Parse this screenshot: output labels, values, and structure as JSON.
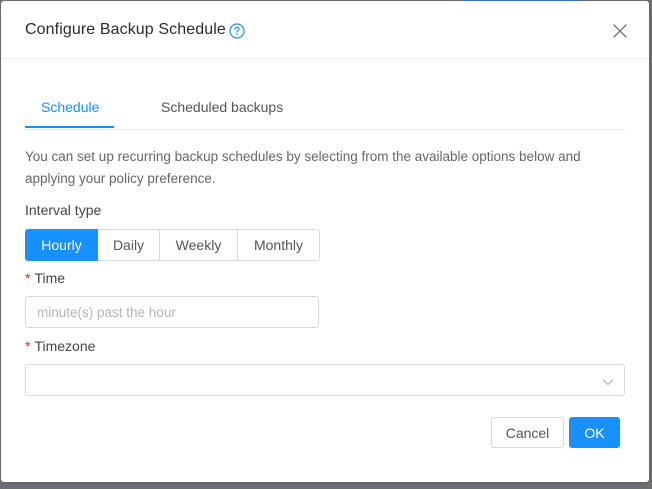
{
  "dialog": {
    "title": "Configure Backup Schedule",
    "help_icon": "question-circle-icon",
    "close_icon": "close-icon"
  },
  "tabs": [
    {
      "label": "Schedule",
      "active": true
    },
    {
      "label": "Scheduled backups",
      "active": false
    }
  ],
  "description": "You can set up recurring backup schedules by selecting from the available options below and applying your policy preference.",
  "interval": {
    "label": "Interval type",
    "options": [
      "Hourly",
      "Daily",
      "Weekly",
      "Monthly"
    ],
    "selected": "Hourly"
  },
  "time": {
    "label": "Time",
    "required": true,
    "value": "",
    "placeholder": "minute(s) past the hour"
  },
  "timezone": {
    "label": "Timezone",
    "required": true,
    "value": ""
  },
  "footer": {
    "cancel_label": "Cancel",
    "ok_label": "OK"
  },
  "colors": {
    "accent": "#1890ff",
    "required": "#f5222d",
    "overlay": "#707376"
  }
}
